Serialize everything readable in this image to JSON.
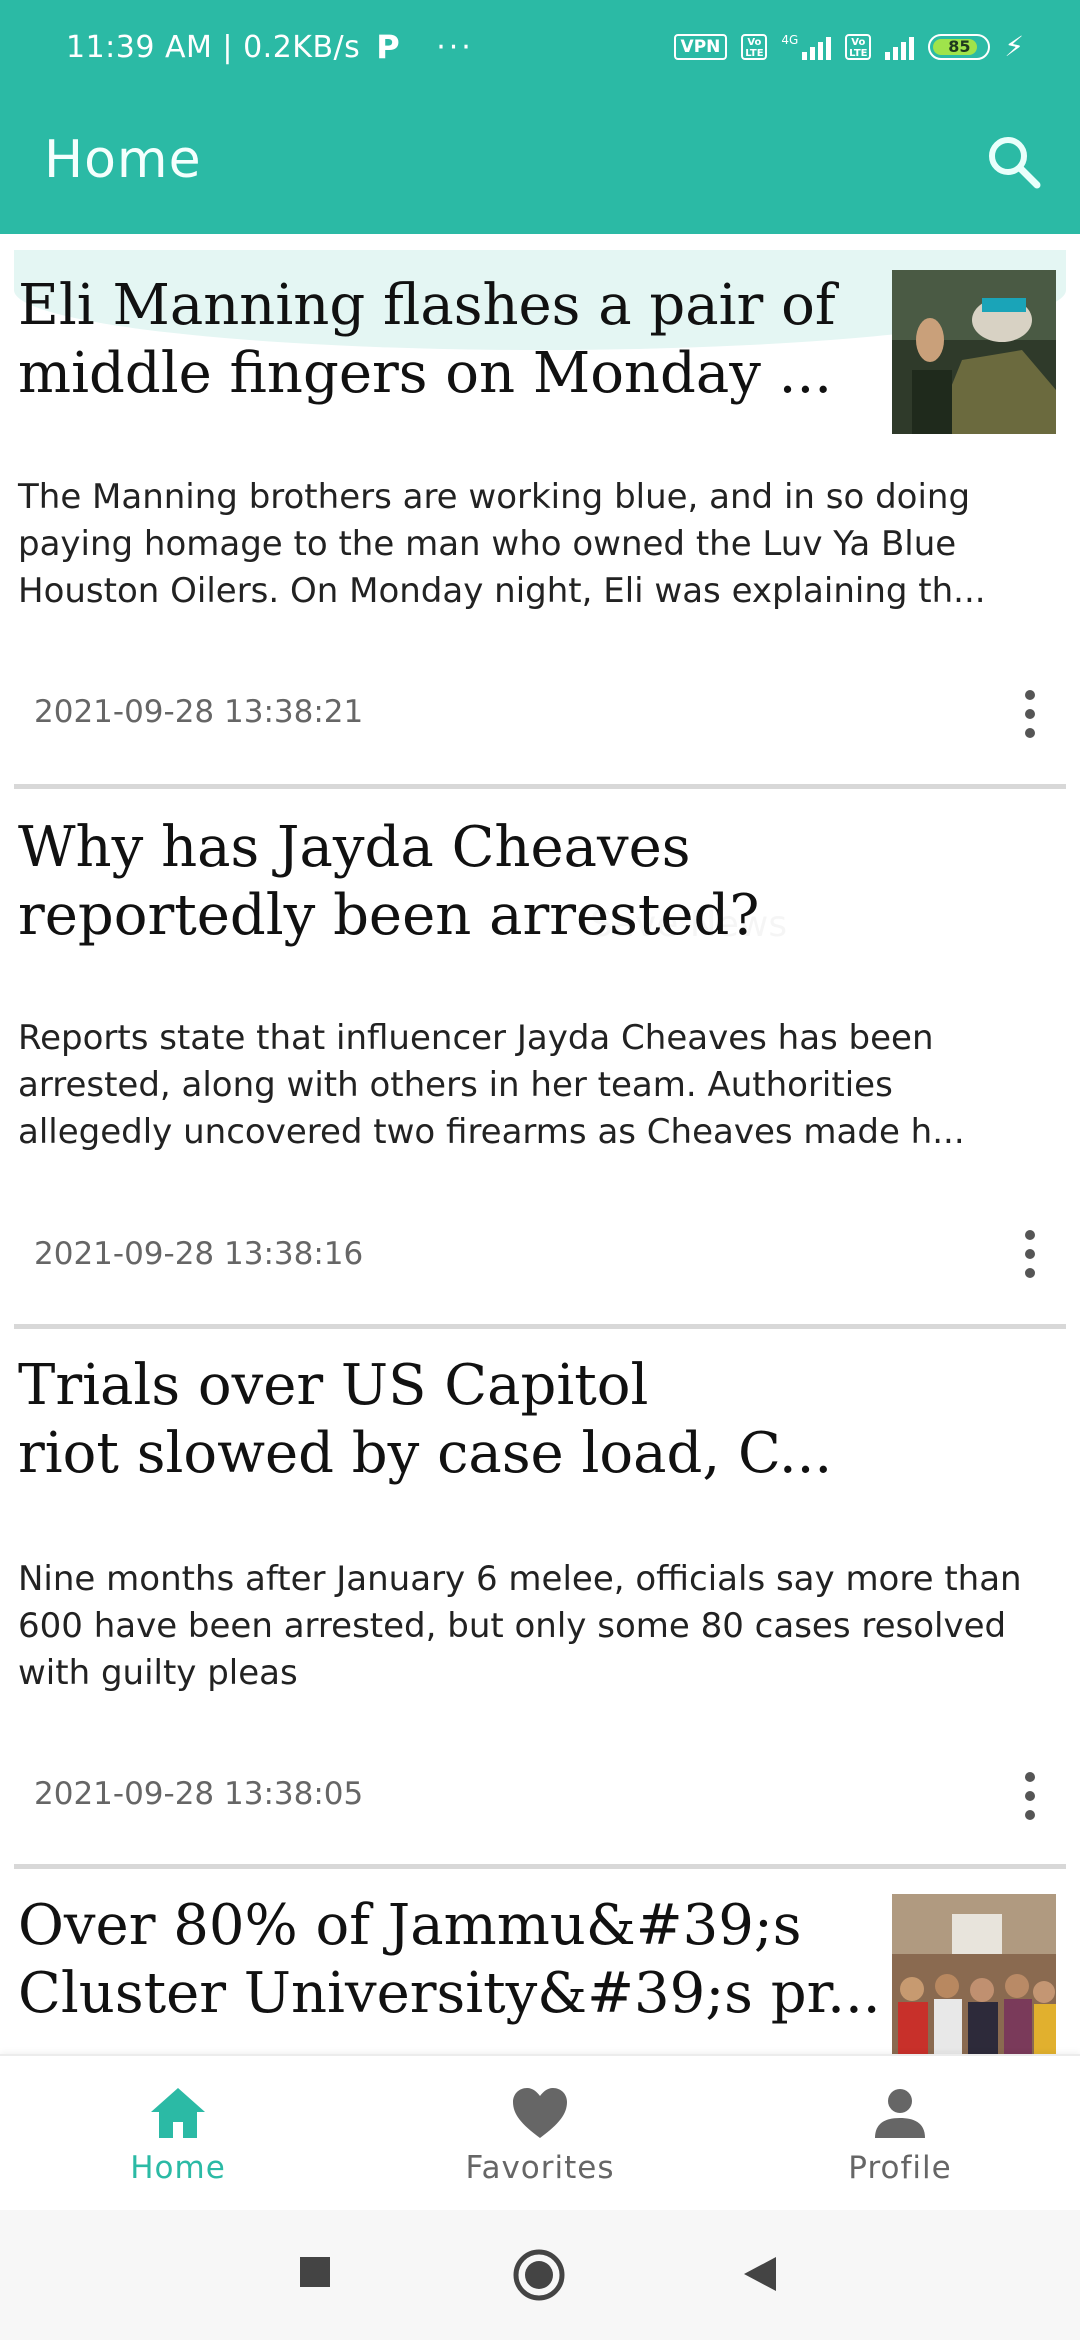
{
  "status_bar": {
    "time_speed": "11:39 AM | 0.2KB/s",
    "p_badge": "P",
    "more": "···",
    "vpn": "VPN",
    "volte": "Vo LTE",
    "network": "4G",
    "battery": "85",
    "battery_level": 0.85
  },
  "app_bar": {
    "title": "Home",
    "search_icon": "search-icon"
  },
  "articles": [
    {
      "title_line1": "Eli Manning flashes a pair of",
      "title_line2": "middle fingers on Monday ...",
      "description": "The Manning brothers are working blue, and in so doing paying homage to the man who owned the Luv Ya Blue Houston Oilers. On Monday night, Eli was explaining th...",
      "date": "2021-09-28 13:38:21",
      "has_thumbnail": true
    },
    {
      "title_line1": "Why has Jayda Cheaves",
      "title_line2": "reportedly been arrested?",
      "description": "Reports state that influencer Jayda Cheaves has been arrested, along with others in her team. Authorities allegedly uncovered two firearms as Cheaves made h...",
      "date": "2021-09-28 13:38:16",
      "has_thumbnail": false
    },
    {
      "title_line1": "Trials over US Capitol",
      "title_line2": "riot slowed by case load, C...",
      "description": "Nine months after January 6 melee, officials say more than 600 have been arrested, but only some 80 cases resolved with guilty pleas",
      "date": "2021-09-28 13:38:05",
      "has_thumbnail": false
    },
    {
      "title_line1": "Over 80% of Jammu&#39;s",
      "title_line2": "Cluster University&#39;s pr...",
      "has_thumbnail": true
    }
  ],
  "ghost_menu": {
    "save_news": "Save News"
  },
  "bottom_nav": {
    "items": [
      {
        "label": "Home",
        "icon": "home-icon",
        "active": true
      },
      {
        "label": "Favorites",
        "icon": "heart-icon",
        "active": false
      },
      {
        "label": "Profile",
        "icon": "person-icon",
        "active": false
      }
    ],
    "active_color": "#2bbaa5",
    "inactive_color": "#666666"
  },
  "system_nav": {
    "recents_icon": "square-icon",
    "home_icon": "circle-icon",
    "back_icon": "triangle-back-icon"
  },
  "colors": {
    "primary": "#2bbaa5",
    "ripple": "#e4f6f3"
  }
}
